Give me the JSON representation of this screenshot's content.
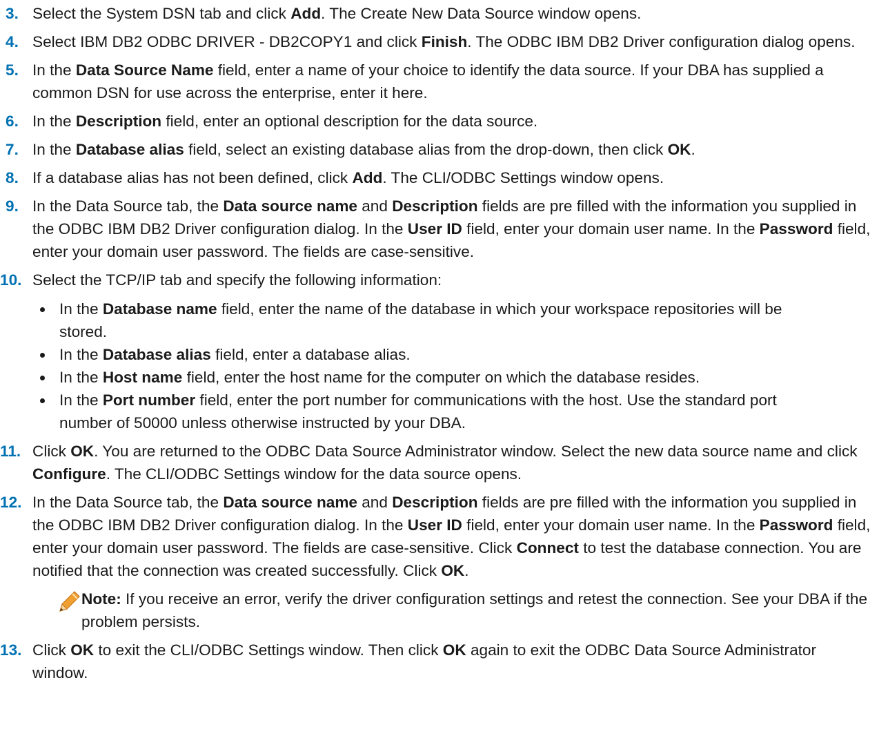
{
  "steps": [
    {
      "num": "3.",
      "segments": [
        {
          "t": "Select the System DSN tab and click "
        },
        {
          "t": "Add",
          "b": true
        },
        {
          "t": ". The Create New Data Source window opens."
        }
      ]
    },
    {
      "num": "4.",
      "segments": [
        {
          "t": "Select IBM DB2 ODBC DRIVER - DB2COPY1 and click "
        },
        {
          "t": "Finish",
          "b": true
        },
        {
          "t": ". The ODBC IBM DB2 Driver configuration dialog opens."
        }
      ]
    },
    {
      "num": "5.",
      "segments": [
        {
          "t": "In the "
        },
        {
          "t": "Data Source Name",
          "b": true
        },
        {
          "t": " field, enter a name of your choice to identify the data source. If your DBA has supplied a common DSN for use across the enterprise, enter it here."
        }
      ]
    },
    {
      "num": "6.",
      "segments": [
        {
          "t": "In the "
        },
        {
          "t": "Description",
          "b": true
        },
        {
          "t": " field, enter an optional description for the data source."
        }
      ]
    },
    {
      "num": "7.",
      "segments": [
        {
          "t": "In the "
        },
        {
          "t": "Database alias",
          "b": true
        },
        {
          "t": " field, select an existing database alias from the drop-down, then click "
        },
        {
          "t": "OK",
          "b": true
        },
        {
          "t": "."
        }
      ]
    },
    {
      "num": "8.",
      "segments": [
        {
          "t": "If a database alias has not been defined, click "
        },
        {
          "t": "Add",
          "b": true
        },
        {
          "t": ". The CLI/ODBC Settings window opens."
        }
      ]
    },
    {
      "num": "9.",
      "segments": [
        {
          "t": "In the Data Source tab, the "
        },
        {
          "t": "Data source name",
          "b": true
        },
        {
          "t": " and "
        },
        {
          "t": "Description",
          "b": true
        },
        {
          "t": " fields are pre filled with the information you supplied in the ODBC IBM DB2 Driver configuration dialog. In the "
        },
        {
          "t": "User ID",
          "b": true
        },
        {
          "t": " field, enter your domain user name. In the "
        },
        {
          "t": "Password",
          "b": true
        },
        {
          "t": " field, enter your domain user password. The fields are case-sensitive."
        }
      ]
    },
    {
      "num": "10.",
      "segments": [
        {
          "t": "Select the TCP/IP tab and specify the following information:"
        }
      ],
      "bullets": [
        [
          {
            "t": "In the "
          },
          {
            "t": "Database name",
            "b": true
          },
          {
            "t": " field, enter the name of the database in which your workspace repositories will be stored."
          }
        ],
        [
          {
            "t": "In the "
          },
          {
            "t": "Database alias",
            "b": true
          },
          {
            "t": " field, enter a database alias."
          }
        ],
        [
          {
            "t": "In the "
          },
          {
            "t": "Host name",
            "b": true
          },
          {
            "t": " field, enter the host name for the computer on which the database resides."
          }
        ],
        [
          {
            "t": "In the "
          },
          {
            "t": "Port number",
            "b": true
          },
          {
            "t": " field, enter the port number for communications with the host. Use the standard port number of 50000 unless otherwise instructed by your DBA."
          }
        ]
      ]
    },
    {
      "num": "11.",
      "segments": [
        {
          "t": "Click "
        },
        {
          "t": "OK",
          "b": true
        },
        {
          "t": ". You are returned to the ODBC Data Source Administrator window. Select the new data source name and click "
        },
        {
          "t": "Configure",
          "b": true
        },
        {
          "t": ". The CLI/ODBC Settings window for the data source opens."
        }
      ]
    },
    {
      "num": "12.",
      "segments": [
        {
          "t": "In the Data Source tab, the "
        },
        {
          "t": "Data source name",
          "b": true
        },
        {
          "t": " and "
        },
        {
          "t": "Description",
          "b": true
        },
        {
          "t": " fields are pre filled with the information you supplied in the ODBC IBM DB2 Driver configuration dialog. In the "
        },
        {
          "t": "User ID",
          "b": true
        },
        {
          "t": " field, enter your domain user name. In the "
        },
        {
          "t": "Password",
          "b": true
        },
        {
          "t": " field, enter your domain user password. The fields are case-sensitive. Click "
        },
        {
          "t": "Connect",
          "b": true
        },
        {
          "t": " to test the database connection. You are notified that the connection was created successfully. Click "
        },
        {
          "t": "OK",
          "b": true
        },
        {
          "t": "."
        }
      ],
      "note": [
        {
          "t": "Note:",
          "b": true
        },
        {
          "t": " If you receive an error, verify the driver configuration settings and retest the connection. See your DBA if the problem persists."
        }
      ]
    },
    {
      "num": "13.",
      "segments": [
        {
          "t": "Click "
        },
        {
          "t": "OK",
          "b": true
        },
        {
          "t": " to exit the CLI/ODBC Settings window. Then click "
        },
        {
          "t": "OK",
          "b": true
        },
        {
          "t": " again to exit the ODBC Data Source Administrator window."
        }
      ]
    }
  ],
  "colors": {
    "step_number": "#0071b3",
    "text": "#1a1a1a",
    "note_icon_body": "#f0a030",
    "note_icon_tip": "#f5d5a0"
  },
  "icons": {
    "note": "pencil-icon"
  }
}
